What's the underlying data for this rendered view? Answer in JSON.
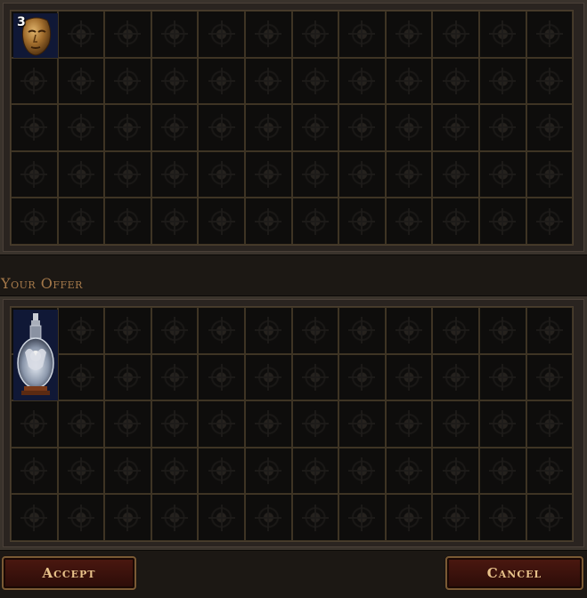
{
  "their_offer": {
    "columns": 12,
    "rows": 5,
    "items": [
      {
        "name": "mask-icon",
        "stack_size": "3"
      }
    ]
  },
  "your_offer": {
    "label": "Your Offer",
    "columns": 12,
    "rows": 5,
    "items": [
      {
        "name": "flask-icon"
      }
    ]
  },
  "buttons": {
    "accept_label": "Accept",
    "cancel_label": "Cancel"
  },
  "colors": {
    "label": "#a5794a",
    "button_text": "#e8c28a",
    "slot_border": "#3e3424",
    "rare_slot_bg": "#101836"
  }
}
